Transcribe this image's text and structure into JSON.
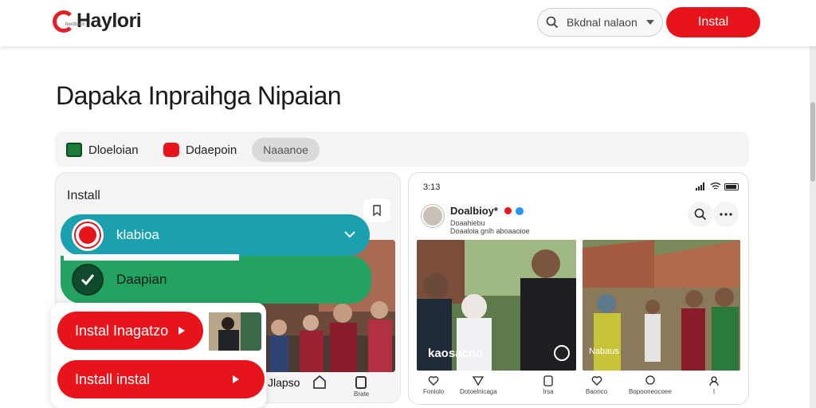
{
  "header": {
    "brand": "Haylori",
    "brand_sub": "feedback",
    "search_text": "Bkdnal nalaon",
    "install_label": "Instal"
  },
  "page": {
    "title": "Dapaka Inpraihga Nipaian"
  },
  "filters": [
    {
      "label": "Dloeloian"
    },
    {
      "label": "Ddaepoin"
    },
    {
      "label": "Naaanoe"
    }
  ],
  "left_card": {
    "heading": "Install",
    "teal_bar_label": "klabioa",
    "green_bar_label": "Daapian",
    "red_buttons": [
      "Instal Inagatzo",
      "Install instal"
    ],
    "bottom_text": "Jlapso",
    "bottom_icon_label": "Brate"
  },
  "right_card": {
    "status_time": "3:13",
    "profile_name": "Doalbioy*",
    "profile_sub": "Doaahiebu",
    "profile_sub2": "Doaaloia gnlh aboaaoioe",
    "caption_left": "kaosacno",
    "caption_right": "Nabaus",
    "bottom_items": [
      {
        "label": "Foniolo"
      },
      {
        "label": "Dotoelnicaga"
      },
      {
        "label": "Irsa"
      },
      {
        "label": "Baonco"
      },
      {
        "label": "Bopooneocoee"
      },
      {
        "label": "I"
      }
    ]
  },
  "colors": {
    "accent_red": "#e8141c",
    "teal": "#1aa0ae",
    "green": "#24a262"
  }
}
